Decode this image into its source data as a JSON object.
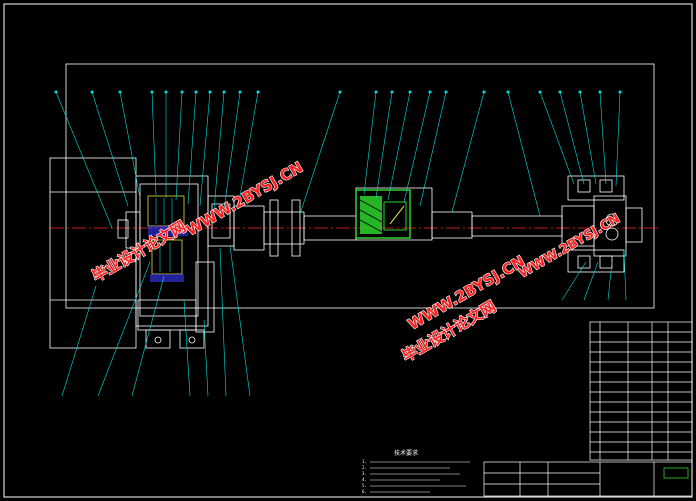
{
  "colors": {
    "background": "#000000",
    "lines": "#ffffff",
    "leaders": "#00e0e0",
    "centerline": "#ff2a2a",
    "highlight": "#2bd52b",
    "yellow": "#ffff33",
    "watermark": "#ff1f1f"
  },
  "watermarks": {
    "site_1": "WWW.2BYSJ.CN",
    "brand_1": "毕业设计论文网",
    "site_2": "WWW.2BYSJ.CN",
    "brand_2": "毕业设计论文网",
    "site_3": "WWW.2BYSJ.CN"
  },
  "notes": {
    "title": "技术要求",
    "lines": [
      "1.",
      "2.",
      "3.",
      "4.",
      "5.",
      "6."
    ]
  }
}
